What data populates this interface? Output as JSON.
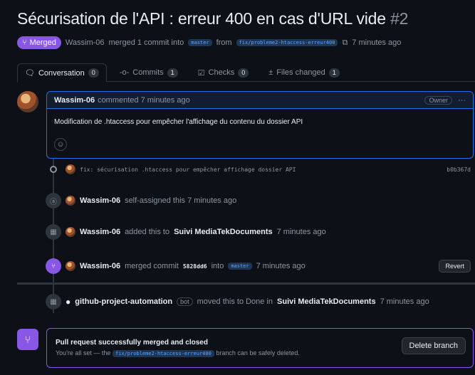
{
  "pr": {
    "title": "Sécurisation de l'API : erreur 400 en cas d'URL vide",
    "number": "#2",
    "state": "Merged",
    "author": "Wassim-06",
    "merge_text": "merged 1 commit into",
    "target_branch": "master",
    "from_text": "from",
    "source_branch": "fix/probleme2-htaccess-erreur400",
    "time": "7 minutes ago"
  },
  "tabs": [
    {
      "label": "Conversation",
      "count": "0",
      "icon": "comment-icon"
    },
    {
      "label": "Commits",
      "count": "1",
      "icon": "commit-icon"
    },
    {
      "label": "Checks",
      "count": "0",
      "icon": "checks-icon"
    },
    {
      "label": "Files changed",
      "count": "1",
      "icon": "file-diff-icon"
    }
  ],
  "comment": {
    "author": "Wassim-06",
    "action": "commented 7 minutes ago",
    "role": "Owner",
    "body": "Modification de .htaccess pour empêcher l'affichage du contenu du dossier API"
  },
  "commit": {
    "message": "fix: sécurisation .htaccess pour empêcher affichage dossier API",
    "sha": "b0b367d"
  },
  "events": {
    "self_assign": {
      "user": "Wassim-06",
      "text": "self-assigned this 7 minutes ago"
    },
    "project_add": {
      "user": "Wassim-06",
      "text": "added this to",
      "project": "Suivi MediaTekDocuments",
      "time": "7 minutes ago"
    },
    "merged": {
      "user": "Wassim-06",
      "text": "merged commit",
      "sha": "5828dd6",
      "into": "into",
      "branch": "master",
      "time": "7 minutes ago",
      "revert_label": "Revert"
    },
    "automation": {
      "user": "github-project-automation",
      "bot_label": "bot",
      "text": "moved this to Done in",
      "project": "Suivi MediaTekDocuments",
      "time": "7 minutes ago"
    }
  },
  "merged_box": {
    "title": "Pull request successfully merged and closed",
    "text_before": "You're all set — the",
    "branch": "fix/probleme2-htaccess-erreur400",
    "text_after": "branch can be safely deleted.",
    "delete_label": "Delete branch"
  }
}
